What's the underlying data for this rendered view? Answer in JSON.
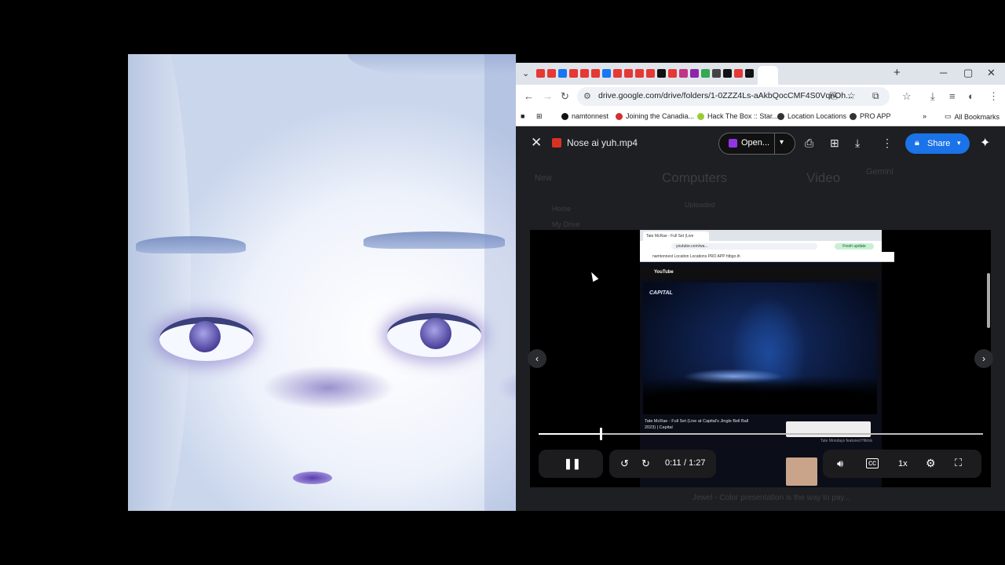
{
  "browser": {
    "active_tab_close": "×",
    "new_tab": "+",
    "window_controls": {
      "minimize": "─",
      "maximize": "▢",
      "close": "✕"
    },
    "url": "drive.google.com/drive/folders/1-0ZZZ4Ls-aAkbQocCMF4S0VqnOh...",
    "tab_favicon_colors": [
      "#e53935",
      "#e53935",
      "#1877f2",
      "#e53935",
      "#e53935",
      "#e53935",
      "#1877f2",
      "#e53935",
      "#e53935",
      "#e53935",
      "#e53935",
      "#111111",
      "#e53935",
      "#c13584",
      "#8e24aa",
      "#34a853",
      "#444444",
      "#111111",
      "#e53935",
      "#111111",
      "#ff6f00",
      "#9c27b0",
      "#5c6bc0",
      "#fb8c00",
      "#e53935",
      "#4caf50",
      "#1a73e8",
      "#1565c0",
      "#111111",
      "#00acc1",
      "#43a047",
      "#3949ab",
      "#111111"
    ],
    "bookmarks": [
      {
        "label": "namtonnest",
        "icon": "github-icon",
        "color": "#111111"
      },
      {
        "label": "Joining the Canadia...",
        "icon": "maple-leaf-icon",
        "color": "#d32f2f"
      },
      {
        "label": "Hack The Box :: Star...",
        "icon": "htb-icon",
        "color": "#9acd32"
      },
      {
        "label": "Location Locations",
        "icon": "globe-icon",
        "color": "#333333"
      },
      {
        "label": "PRO APP",
        "icon": "globe-icon",
        "color": "#333333"
      }
    ],
    "all_bookmarks": "All Bookmarks"
  },
  "preview": {
    "file_name": "Nose ai yuh.mp4",
    "open_label": "Open...",
    "share_label": "Share",
    "accent": "#1a73e8"
  },
  "drive_background": {
    "new": "New",
    "home": "Home",
    "my_drive": "My Drive",
    "breadcrumb_computers": "Computers",
    "breadcrumb_video": "Video",
    "gemini": "Gemini",
    "filter": "Uploaded",
    "footer_text": "Jewel - Color presentation is the way to pay..."
  },
  "inner_video": {
    "tab_title": "Tate McRae - Full Set (Live",
    "url": "youtube.com/wa...",
    "fresh_update": "Fresh update",
    "bookmarks_line": "namtonnest   Location Locations   PRO APP   htbgo.ih",
    "yt_logo": "YouTube",
    "capital_logo": "CAPITAL",
    "title": "Tate McRae - Full Set (Live at Capital's Jingle Bell Ball 2023) | Capital",
    "list": "Tate Mondays featured Hitmix"
  },
  "player": {
    "current_time": "0:11",
    "duration": "/ 1:27",
    "progress": 0.14,
    "speed": "1x",
    "pause_icon": "pause-icon"
  }
}
